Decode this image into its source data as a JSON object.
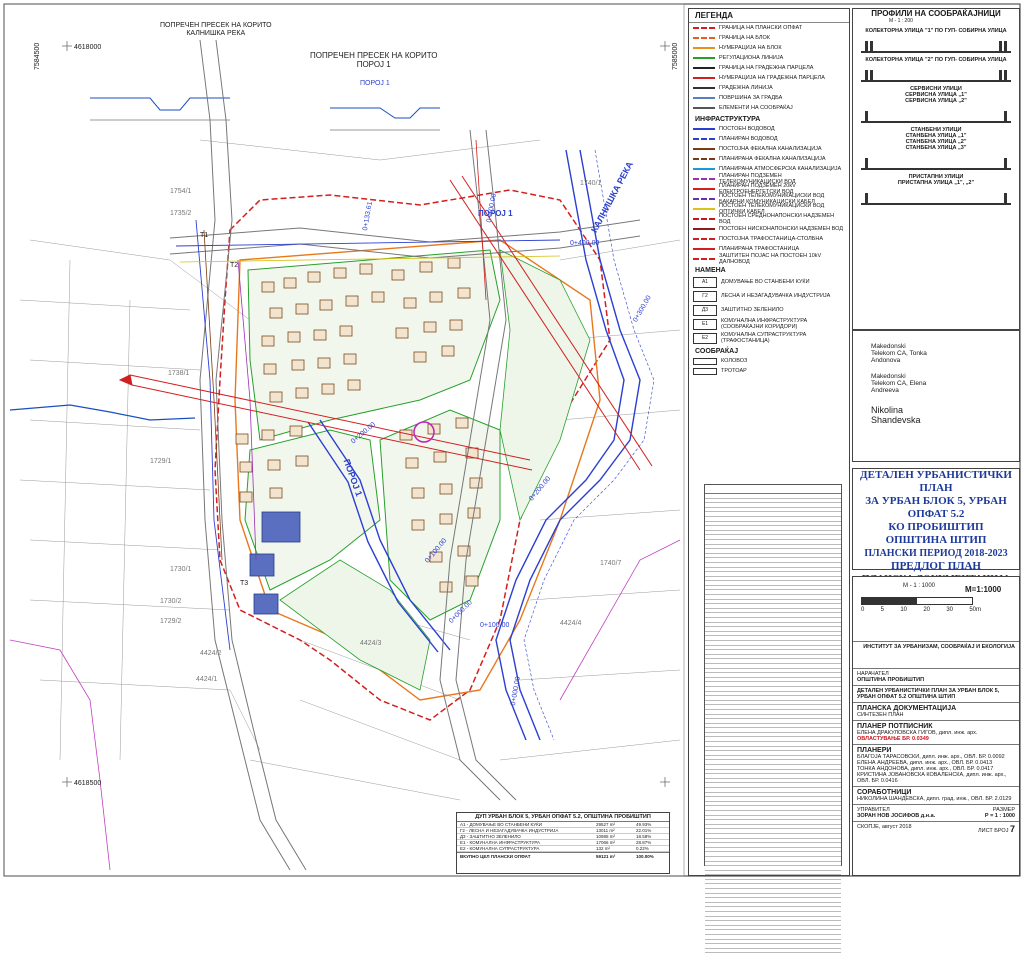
{
  "map": {
    "section_title_1": "ПОПРЕЧЕН ПРЕСЕК НА КОРИТО\nКАЛНИШКА РЕКА",
    "section_title_2": "ПОПРЕЧЕН ПРЕСЕК НА КОРИТО\nПОРОЈ 1",
    "grid_label_1": "4618000",
    "grid_label_2": "4618500",
    "grid_label_3": "7584500",
    "grid_label_4": "7585000",
    "river_label": "КАЛНИШКА РЕКА",
    "stream_label_1": "ПОРОЈ 1",
    "stream_label_2": "ПОРОЈ 1",
    "stream_label_3": "ПОРОЈ 1",
    "chainages": [
      "0+000.00",
      "0+100.00",
      "0+200.00",
      "0+300.00",
      "0+400.00",
      "0+133.61",
      "0+100.00",
      "0+000.00",
      "0+100.00",
      "0+200.00"
    ],
    "road_labels": [
      "Т1",
      "Т2",
      "Т3"
    ],
    "plot_labels": [
      "1754/1",
      "1735/2",
      "1738/1",
      "1729/1",
      "1730/1",
      "1730/2",
      "1729/2",
      "1740/1",
      "1740/7",
      "4424/1",
      "4424/2",
      "4424/3",
      "4424/4"
    ]
  },
  "legend": {
    "title": "ЛЕГЕНДА",
    "items": [
      {
        "label": "ГРАНИЦА НА ПЛАНСКИ ОПФАТ",
        "color": "#d21f1f"
      },
      {
        "label": "ГРАНИЦА НА БЛОК",
        "color": "#e85c1c"
      },
      {
        "label": "НУМЕРАЦИЈА НА БЛОК",
        "color": "#e8901c"
      },
      {
        "label": "РЕГУЛАЦИОНА ЛИНИЈА",
        "color": "#27a02b"
      },
      {
        "label": "ГРАНИЦА НА ГРАДЕЖНА ПАРЦЕЛА",
        "color": "#222222"
      },
      {
        "label": "НУМЕРАЦИЈА НА ГРАДЕЖНА ПАРЦЕЛА",
        "color": "#d21f1f"
      },
      {
        "label": "ГРАДЕЖНА ЛИНИЈА",
        "color": "#333333"
      },
      {
        "label": "ПОВРШИНА ЗА ГРАДБА",
        "color": "#5a7fbf"
      },
      {
        "label": "ЕЛЕМЕНТИ НА СООБРАЌАЈ",
        "color": "#555555"
      }
    ],
    "infra_title": "ИНФРАСТРУКТУРА",
    "infra": [
      {
        "label": "ПОСТОЕН ВОДОВОД",
        "color": "#2b3fd0"
      },
      {
        "label": "ПЛАНИРАН ВОДОВОД",
        "color": "#2b3fd0"
      },
      {
        "label": "ПОСТОЈНА ФЕКАЛНА КАНАЛИЗАЦИЈА",
        "color": "#7a3b12"
      },
      {
        "label": "ПЛАНИРАНА ФЕКАЛНА КАНАЛИЗАЦИЈА",
        "color": "#7a3b12"
      },
      {
        "label": "ПЛАНИРАНА АТМОСФЕРСКА КАНАЛИЗАЦИЈА",
        "color": "#1a9ad6"
      },
      {
        "label": "ПЛАНИРАН ПОДЗЕМЕН ТЕЛЕКОМУНИКАЦИСКИ ВОД",
        "color": "#9b2fb5"
      },
      {
        "label": "ПЛАНИРАН ПОДЗЕМЕН 20kV ЕЛЕКТРОЕНЕРГЕТСКИ ВОД",
        "color": "#d21f1f"
      },
      {
        "label": "ПОСТОЕН ТЕЛЕКОМУНИКАЦИСКИ ВОД БАКАРНИ КОМУНИКАЦИСКИ КАБЕЛ",
        "color": "#6b2fb5"
      },
      {
        "label": "ПОСТОЕН ТЕЛЕКОМУНИКАЦИСКИ ВОД ОПТИЧКИ КАБЕЛ",
        "color": "#d6c21a"
      },
      {
        "label": "ПОСТОЕН СРЕДНОНАПОНСКИ НАДЗЕМЕН ВОД",
        "color": "#c4161c"
      },
      {
        "label": "ПОСТОЕН НИСКОНАПОНСКИ НАДЗЕМЕН ВОД",
        "color": "#8a1c1c"
      },
      {
        "label": "ПОСТОЈНА ТРАФОСТАНИЦА-СТОЛБНА",
        "color": "#d21f1f"
      },
      {
        "label": "ПЛАНИРАНА ТРАФОСТАНИЦА",
        "color": "#d21f1f"
      },
      {
        "label": "ЗАШТИТЕН ПОЈАС НА ПОСТОЕН 10kV ДАЛНОВОД",
        "color": "#d21f1f"
      }
    ],
    "use_title": "НАМЕНА",
    "uses": [
      {
        "code": "А1",
        "label": "ДОМУВАЊЕ ВО СТАНБЕНИ КУЌИ"
      },
      {
        "code": "Г2",
        "label": "ЛЕСНА И НЕЗАГАДУВАЧКА ИНДУСТРИЈА"
      },
      {
        "code": "Д3",
        "label": "ЗАШТИТНО ЗЕЛЕНИЛО"
      },
      {
        "code": "Е1",
        "label": "КОМУНАЛНА ИНФРАСТРУКТУРА (СООБРАЌАЈНИ КОРИДОРИ)"
      },
      {
        "code": "Е2",
        "label": "КОМУНАЛНА СУПРАСТРУКТУРА (ТРАФОСТАНИЦА)"
      }
    ],
    "traffic_title": "СООБРАЌАЈ",
    "traffic": [
      {
        "label": "КОЛОВОЗ"
      },
      {
        "label": "ТРОТОАР"
      }
    ]
  },
  "profiles": {
    "title": "ПРОФИЛИ НА СООБРАЌАЈНИЦИ",
    "scale": "М - 1 : 200",
    "items": [
      {
        "label": "КОЛЕКТОРНА УЛИЦА \"1\" ПО ГУП- СОБИРНА УЛИЦА"
      },
      {
        "label": "КОЛЕКТОРНА УЛИЦА \"2\" ПО ГУП- СОБИРНА УЛИЦА"
      },
      {
        "label": "СЕРВИСНИ УЛИЦИ\nСЕРВИСНА УЛИЦА „1\"\nСЕРВИСНА УЛИЦА „2\""
      },
      {
        "label": "СТАНБЕНИ УЛИЦИ\nСТАНБЕНА УЛИЦА „1\"\nСТАНБЕНА УЛИЦА „2\"\nСТАНБЕНА УЛИЦА „3\""
      },
      {
        "label": "ПРИСТАПНИ УЛИЦИ\nПРИСТАПНА УЛИЦА „1\", „2\""
      }
    ]
  },
  "signatures": {
    "sig1": "Makedonski Telekom CA, Tonka Andonova",
    "sig2": "Makedonski Telekom CA, Elena Andreeva",
    "sig3": "Nikolina Shandevska"
  },
  "title_block": {
    "line1": "ДЕТАЛЕН УРБАНИСТИЧКИ ПЛАН",
    "line2": "ЗА УРБАН БЛОК 5, УРБАН ОПФАТ 5.2",
    "line3": "КО ПРОБИШТИП",
    "line4": "ОПШТИНА ШТИП",
    "line5": "ПЛАНСКИ ПЕРИОД 2018-2023",
    "line6": "ПРЕДЛОГ ПЛАН",
    "line7": "ПЛАНСКА ДОКУМЕНТАЦИЈА",
    "line8": "М=1:1000"
  },
  "scale_bar": {
    "label": "М - 1 : 1000",
    "ticks": [
      "0",
      "5",
      "10",
      "20",
      "30",
      "50m"
    ]
  },
  "titleblock_lower": {
    "institute": "ИНСТИТУТ ЗА УРБАНИЗАМ, СООБРАЌАЈ И ЕКОЛОГИЈА",
    "client_label": "НАРАЧАТЕЛ",
    "client": "ОПШТИНА ПРОБИШТИП",
    "plan": "ДЕТАЛЕН УРБАНИСТИЧКИ ПЛАН ЗА УРБАН БЛОК 5, УРБАН ОПФАТ 5.2 ОПШТИНА ШТИП",
    "doc": "ПЛАНСКА ДОКУМЕНТАЦИЈА",
    "doc_sub": "СИНТЕЗЕН ПЛАН",
    "planner_label": "ПЛАНЕР ПОТПИСНИК",
    "planner": "ЕЛЕНА ДРАКУЛОВСКА ГИГОВ, дипл. инж. арх.",
    "license": "ОВЛАСТУВАЊЕ БР. 0.0349",
    "planners_label": "ПЛАНЕРИ",
    "planners": [
      "БЛАГОЈА ТАРАСОВСКИ, дипл. инж. арх., ОВЛ. БР. 0.0092",
      "ЕЛЕНА АНДРЕЕВА, дипл. инж. арх., ОВЛ. БР. 0.0413",
      "ТОНКА АНДОНОВА, дипл. инж. арх., ОВЛ. БР. 0.0417",
      "КРИСТИНА ЈОВАНОВСКА КОВАЛЕНСКА, дипл. инж. арх., ОВЛ. БР. 0.0416"
    ],
    "collab_label": "СОРАБОТНИЦИ",
    "collab": "НИКОЛИНА ШАНДЕВСКА, дипл. град. инж., ОВЛ. БР. 2.0129",
    "director_label": "УПРАВИТЕЛ",
    "director": "ЗОРАН НОВ ЈОСИФОВ д.н.а.",
    "scale_label": "РАЗМЕР",
    "scale": "Р = 1 : 1000",
    "sheet_label": "ЛИСТ БРОЈ",
    "sheet": "7",
    "date": "СКОПЈЕ, август 2018"
  },
  "table2": {
    "title": "ДУП УРБАН БЛОК 5, УРБАН ОПФАТ 5.2, ОПШТИНА ПРОБИШТИП",
    "rows": [
      "А1 - ДОМУВАЊЕ ВО СТАНБЕНИ КУЌИ",
      "Г2 - ЛЕСНА И НЕЗАГАДУВАЧКА ИНДУСТРИЈА",
      "Д3 - ЗАШТИТНО ЗЕЛЕНИЛО",
      "Е1 - КОМУНАЛНА ИНФРАСТРУКТУРА",
      "Е2 - КОМУНАЛНА СУПРАСТРУКТУРА"
    ],
    "values": [
      "29527 m²",
      "13011 m²",
      "10985 m²",
      "17066 m²",
      "132 m²"
    ],
    "percent": [
      "49.93%",
      "22.01%",
      "18.58%",
      "28.87%",
      "0.22%"
    ],
    "total_label": "ВКУПНО ЦЕЛ ПЛАНСКИ ОПФАТ",
    "total": "59121 m²",
    "total_percent": "100.00%"
  },
  "colors": {
    "boundary": "#d21f1f",
    "block": "#e8a21c",
    "regulation": "#27a02b",
    "water": "#2b3fd0",
    "building": "#5a7fbf",
    "title": "#1d3a9a"
  }
}
